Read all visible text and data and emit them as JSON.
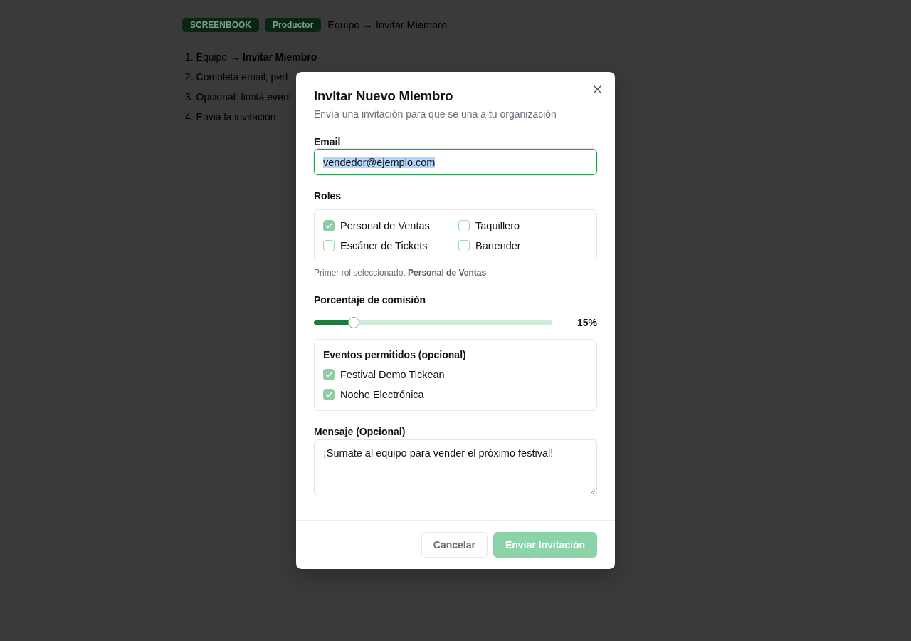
{
  "header": {
    "badges": [
      {
        "label": "SCREENBOOK"
      },
      {
        "label": "Productor"
      }
    ],
    "breadcrumb": "Equipo → Invitar Miembro"
  },
  "steps": [
    "1. Equipo → **Invitar Miembro**",
    "2. Completá email, perf",
    "3. Opcional: limitá event",
    "4. Enviá la invitación"
  ],
  "dialog": {
    "title": "Invitar Nuevo Miembro",
    "subtitle": "Envía una invitación para que se una a tu organización",
    "email": {
      "label": "Email",
      "value": "vendedor@ejemplo.com",
      "focused": true,
      "text_selected": true
    },
    "roles": {
      "label": "Roles",
      "options": [
        {
          "label": "Personal de Ventas",
          "checked": true
        },
        {
          "label": "Taquillero",
          "checked": false
        },
        {
          "label": "Escáner de Tickets",
          "checked": false
        },
        {
          "label": "Bartender",
          "checked": false
        }
      ],
      "hint": "Primer rol seleccionado: **Personal de Ventas**"
    },
    "commission": {
      "label": "Porcentaje de comisión",
      "level": 0.15,
      "reading": "15%"
    },
    "events": {
      "title": "Eventos permitidos (opcional)",
      "items": [
        {
          "label": "Festival Demo Tickean",
          "checked": true
        },
        {
          "label": "Noche Electrónica",
          "checked": true
        }
      ]
    },
    "message": {
      "label": "Mensaje (Opcional)",
      "value": "¡Sumate al equipo para vender el próximo festival!"
    },
    "buttons": [
      {
        "label": "Cancelar",
        "kind": "secondary",
        "disabled": false
      },
      {
        "label": "Enviar Invitación",
        "kind": "primary",
        "disabled": true
      }
    ]
  }
}
